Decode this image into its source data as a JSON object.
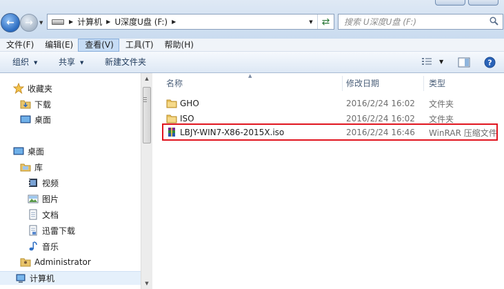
{
  "address": {
    "crumbs": [
      "计算机",
      "U深度U盘 (F:)"
    ]
  },
  "search": {
    "placeholder": "搜索 U深度U盘 (F:)"
  },
  "menu": [
    "文件(F)",
    "编辑(E)",
    "查看(V)",
    "工具(T)",
    "帮助(H)"
  ],
  "menu_active_index": 2,
  "toolbar": {
    "organize": "组织",
    "share": "共享",
    "new_folder": "新建文件夹"
  },
  "nav": {
    "favorites": "收藏夹",
    "downloads": "下载",
    "desktop_fav": "桌面",
    "desktop": "桌面",
    "libraries": "库",
    "videos": "视频",
    "pictures": "图片",
    "documents": "文档",
    "thunder": "迅雷下载",
    "music": "音乐",
    "administrator": "Administrator",
    "computer": "计算机"
  },
  "columns": {
    "name": "名称",
    "date": "修改日期",
    "type": "类型"
  },
  "files": [
    {
      "name": "GHO",
      "date": "2016/2/24 16:02",
      "type": "文件夹",
      "icon": "folder-icon"
    },
    {
      "name": "ISO",
      "date": "2016/2/24 16:02",
      "type": "文件夹",
      "icon": "folder-icon"
    },
    {
      "name": "LBJY-WIN7-X86-2015X.iso",
      "date": "2016/2/24 16:46",
      "type": "WinRAR 压缩文件",
      "icon": "winrar-icon"
    }
  ],
  "colors": {
    "highlight": "#e0141e",
    "selection": "#e5f0fb"
  }
}
